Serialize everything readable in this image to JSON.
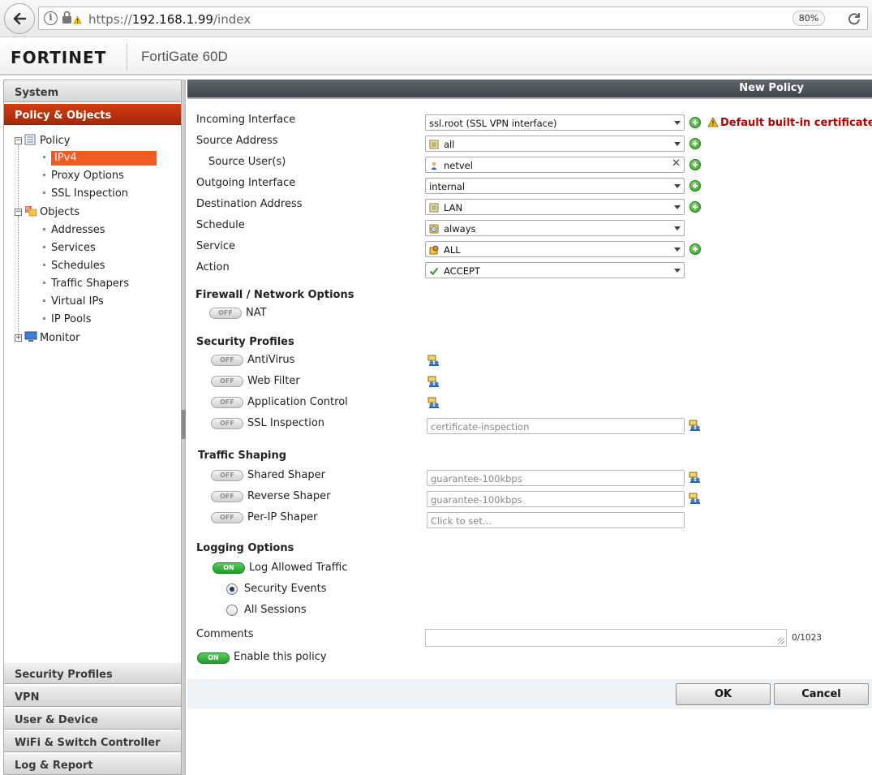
{
  "browser": {
    "url_prefix": "https://",
    "url_host": "192.168.1.99",
    "url_path": "/index",
    "zoom": "80%"
  },
  "header": {
    "logo": "FORTINET",
    "model": "FortiGate 60D"
  },
  "sidebar": {
    "top_sections": [
      "System",
      "Policy & Objects"
    ],
    "tree": {
      "policy": "Policy",
      "ipv4": "IPv4",
      "proxy_options": "Proxy Options",
      "ssl_inspection": "SSL Inspection",
      "objects": "Objects",
      "addresses": "Addresses",
      "services": "Services",
      "schedules": "Schedules",
      "traffic_shapers": "Traffic Shapers",
      "virtual_ips": "Virtual IPs",
      "ip_pools": "IP Pools",
      "monitor": "Monitor"
    },
    "bottom_sections": [
      "Security Profiles",
      "VPN",
      "User & Device",
      "WiFi & Switch Controller",
      "Log & Report"
    ]
  },
  "panel": {
    "title": "New Policy",
    "fields": {
      "incoming_interface": {
        "label": "Incoming Interface",
        "value": "ssl.root (SSL VPN interface)"
      },
      "source_address": {
        "label": "Source Address",
        "value": "all"
      },
      "source_users": {
        "label": "Source User(s)",
        "value": "netvel"
      },
      "outgoing_interface": {
        "label": "Outgoing Interface",
        "value": "internal"
      },
      "destination_address": {
        "label": "Destination Address",
        "value": "LAN"
      },
      "schedule": {
        "label": "Schedule",
        "value": "always"
      },
      "service": {
        "label": "Service",
        "value": "ALL"
      },
      "action": {
        "label": "Action",
        "value": "ACCEPT"
      }
    },
    "warning": "Default built-in certificate",
    "firewall_section": "Firewall / Network Options",
    "nat": {
      "label": "NAT",
      "state": "OFF"
    },
    "security_section": "Security Profiles",
    "security": {
      "antivirus": {
        "label": "AntiVirus",
        "state": "OFF"
      },
      "web_filter": {
        "label": "Web Filter",
        "state": "OFF"
      },
      "app_control": {
        "label": "Application Control",
        "state": "OFF"
      },
      "ssl_inspection": {
        "label": "SSL Inspection",
        "state": "OFF",
        "value": "certificate-inspection"
      }
    },
    "shaping_section": "Traffic Shaping",
    "shaping": {
      "shared": {
        "label": "Shared Shaper",
        "state": "OFF",
        "value": "guarantee-100kbps"
      },
      "reverse": {
        "label": "Reverse Shaper",
        "state": "OFF",
        "value": "guarantee-100kbps"
      },
      "per_ip": {
        "label": "Per-IP Shaper",
        "state": "OFF",
        "placeholder": "Click to set..."
      }
    },
    "logging_section": "Logging Options",
    "logging": {
      "log_allowed": {
        "label": "Log Allowed Traffic",
        "state": "ON"
      },
      "security_events": "Security Events",
      "all_sessions": "All Sessions"
    },
    "comments": {
      "label": "Comments",
      "value": "",
      "count": "0/1023"
    },
    "enable_policy": {
      "label": "Enable this policy",
      "state": "ON"
    },
    "buttons": {
      "ok": "OK",
      "cancel": "Cancel"
    }
  }
}
